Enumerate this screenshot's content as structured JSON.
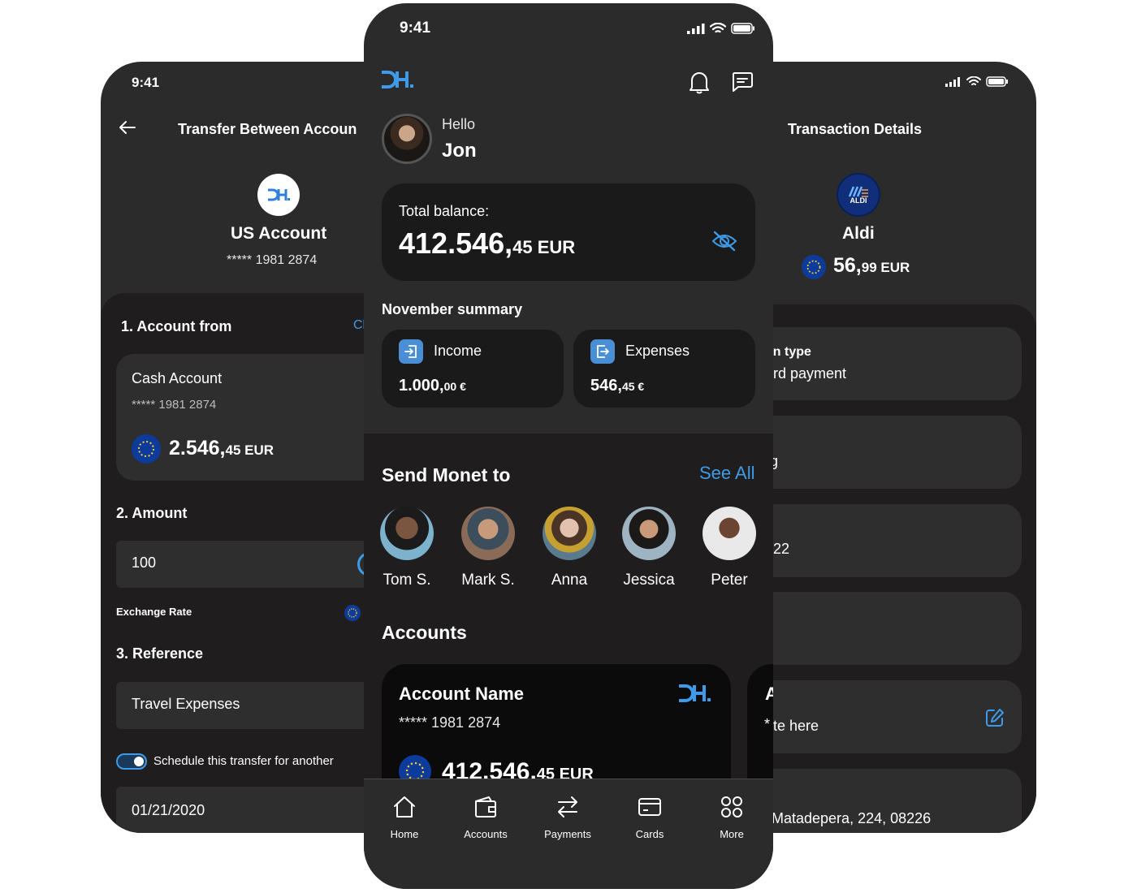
{
  "left_screen": {
    "time": "9:41",
    "title": "Transfer Between Accoun",
    "account_title": "US Account",
    "account_number": "***** 1981 2874",
    "section_from": "1. Account from",
    "change_link": "Cl",
    "from_name": "Cash Account",
    "from_number": "***** 1981 2874",
    "from_balance_main": "2.546,",
    "from_balance_small": "45 EUR",
    "section_amount": "2. Amount",
    "amount_value": "100",
    "exchange_label": "Exchange Rate",
    "section_reference": "3. Reference",
    "reference_value": "Travel Expenses",
    "schedule_label": "Schedule this transfer for another",
    "date_value": "01/21/2020"
  },
  "center_screen": {
    "time": "9:41",
    "greeting": "Hello",
    "user_name": "Jon",
    "balance_label": "Total balance:",
    "balance_main": "412.546,",
    "balance_small": "45 EUR",
    "summary_title": "November summary",
    "income_label": "Income",
    "income_main": "1.000,",
    "income_small": "00 €",
    "expenses_label": "Expenses",
    "expenses_main": "546,",
    "expenses_small": "45 €",
    "send_title": "Send Monet to",
    "see_all": "See All",
    "contacts": [
      "Tom S.",
      "Mark S.",
      "Anna",
      "Jessica",
      "Peter"
    ],
    "accounts_title": "Accounts",
    "card_name": "Account Name",
    "card_number": "***** 1981 2874",
    "card_balance_main": "412.546,",
    "card_balance_small": "45 EUR",
    "peek_letter": "A",
    "peek_star": "*",
    "nav": [
      "Home",
      "Accounts",
      "Payments",
      "Cards",
      "More"
    ]
  },
  "right_screen": {
    "title": "Transaction Details",
    "merchant_logo_text": "ALDI",
    "merchant": "Aldi",
    "amount_main": "56,",
    "amount_small": "99 EUR",
    "row1_label": "on type",
    "row1_value": "rd payment",
    "row2_value": "g",
    "row3_value": "22",
    "row5_value": "te here",
    "row6_value": "Matadepera, 224, 08226"
  },
  "colors": {
    "accent": "#3d9be9",
    "phone_bg": "#2b2b2b",
    "sheet_bg": "#1f1d1d",
    "card_bg": "#1b1a1a"
  }
}
